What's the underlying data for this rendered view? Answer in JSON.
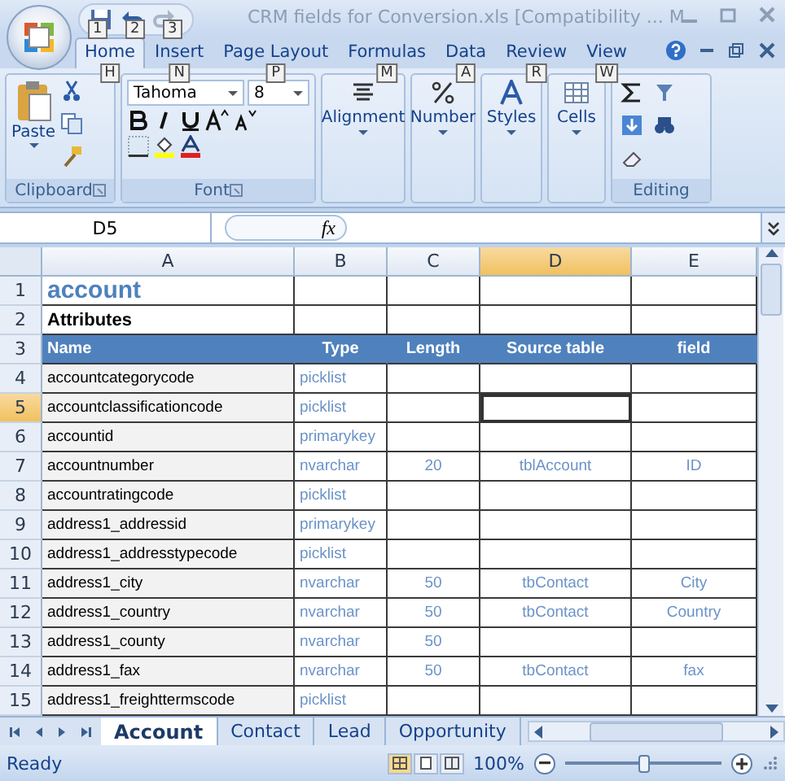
{
  "window": {
    "title": "CRM fields for Conversion.xls  [Compatibility ... M",
    "quick_access_key_tips": [
      "1",
      "2",
      "3"
    ]
  },
  "ribbon_tabs": [
    {
      "label": "Home",
      "key_tip": "H",
      "selected": true
    },
    {
      "label": "Insert",
      "key_tip": "N",
      "selected": false
    },
    {
      "label": "Page Layout",
      "key_tip": "P",
      "selected": false
    },
    {
      "label": "Formulas",
      "key_tip": "M",
      "selected": false
    },
    {
      "label": "Data",
      "key_tip": "A",
      "selected": false
    },
    {
      "label": "Review",
      "key_tip": "R",
      "selected": false
    },
    {
      "label": "View",
      "key_tip": "W",
      "selected": false
    }
  ],
  "ribbon": {
    "paste_label": "Paste",
    "font_name": "Tahoma",
    "font_size": "8",
    "groups": [
      "Clipboard",
      "Font"
    ],
    "collapsed_groups": [
      "Alignment",
      "Number",
      "Styles",
      "Cells"
    ],
    "editing_label": "Editing"
  },
  "formula_bar": {
    "name_box": "D5",
    "fx": "fx"
  },
  "columns": [
    {
      "letter": "A",
      "selected": false
    },
    {
      "letter": "B",
      "selected": false
    },
    {
      "letter": "C",
      "selected": false
    },
    {
      "letter": "D",
      "selected": true
    },
    {
      "letter": "E",
      "selected": false
    }
  ],
  "rows": [
    {
      "number": "1",
      "kind": "title",
      "selected": false,
      "cells": {
        "A": "account"
      }
    },
    {
      "number": "2",
      "kind": "subtitle",
      "selected": false,
      "cells": {
        "A": "Attributes"
      }
    },
    {
      "number": "3",
      "kind": "header",
      "selected": false,
      "cells": {
        "A": "Name",
        "B": "Type",
        "C": "Length",
        "D": "Source table",
        "E": "field"
      }
    },
    {
      "number": "4",
      "kind": "data",
      "selected": false,
      "cells": {
        "A": "accountcategorycode",
        "B": "picklist"
      }
    },
    {
      "number": "5",
      "kind": "data",
      "selected": true,
      "cells": {
        "A": "accountclassificationcode",
        "B": "picklist"
      }
    },
    {
      "number": "6",
      "kind": "data",
      "selected": false,
      "cells": {
        "A": "accountid",
        "B": "primarykey"
      }
    },
    {
      "number": "7",
      "kind": "data",
      "selected": false,
      "cells": {
        "A": "accountnumber",
        "B": "nvarchar",
        "C": "20",
        "D": "tblAccount",
        "E": "ID"
      }
    },
    {
      "number": "8",
      "kind": "data",
      "selected": false,
      "cells": {
        "A": "accountratingcode",
        "B": "picklist"
      }
    },
    {
      "number": "9",
      "kind": "data",
      "selected": false,
      "cells": {
        "A": "address1_addressid",
        "B": "primarykey"
      }
    },
    {
      "number": "10",
      "kind": "data",
      "selected": false,
      "cells": {
        "A": "address1_addresstypecode",
        "B": "picklist"
      }
    },
    {
      "number": "11",
      "kind": "data",
      "selected": false,
      "cells": {
        "A": "address1_city",
        "B": "nvarchar",
        "C": "50",
        "D": "tbContact",
        "E": "City"
      }
    },
    {
      "number": "12",
      "kind": "data",
      "selected": false,
      "cells": {
        "A": "address1_country",
        "B": "nvarchar",
        "C": "50",
        "D": "tbContact",
        "E": "Country"
      }
    },
    {
      "number": "13",
      "kind": "data",
      "selected": false,
      "cells": {
        "A": "address1_county",
        "B": "nvarchar",
        "C": "50"
      }
    },
    {
      "number": "14",
      "kind": "data",
      "selected": false,
      "cells": {
        "A": "address1_fax",
        "B": "nvarchar",
        "C": "50",
        "D": "tbContact",
        "E": "fax"
      }
    },
    {
      "number": "15",
      "kind": "data",
      "selected": false,
      "cells": {
        "A": "address1_freighttermscode",
        "B": "picklist"
      }
    }
  ],
  "sheet_tabs": [
    {
      "label": "Account",
      "selected": true
    },
    {
      "label": "Contact",
      "selected": false
    },
    {
      "label": "Lead",
      "selected": false
    },
    {
      "label": "Opportunity",
      "selected": false
    }
  ],
  "status_bar": {
    "status": "Ready",
    "zoom": "100%",
    "zoom_level": {
      "level": 0.5
    }
  }
}
